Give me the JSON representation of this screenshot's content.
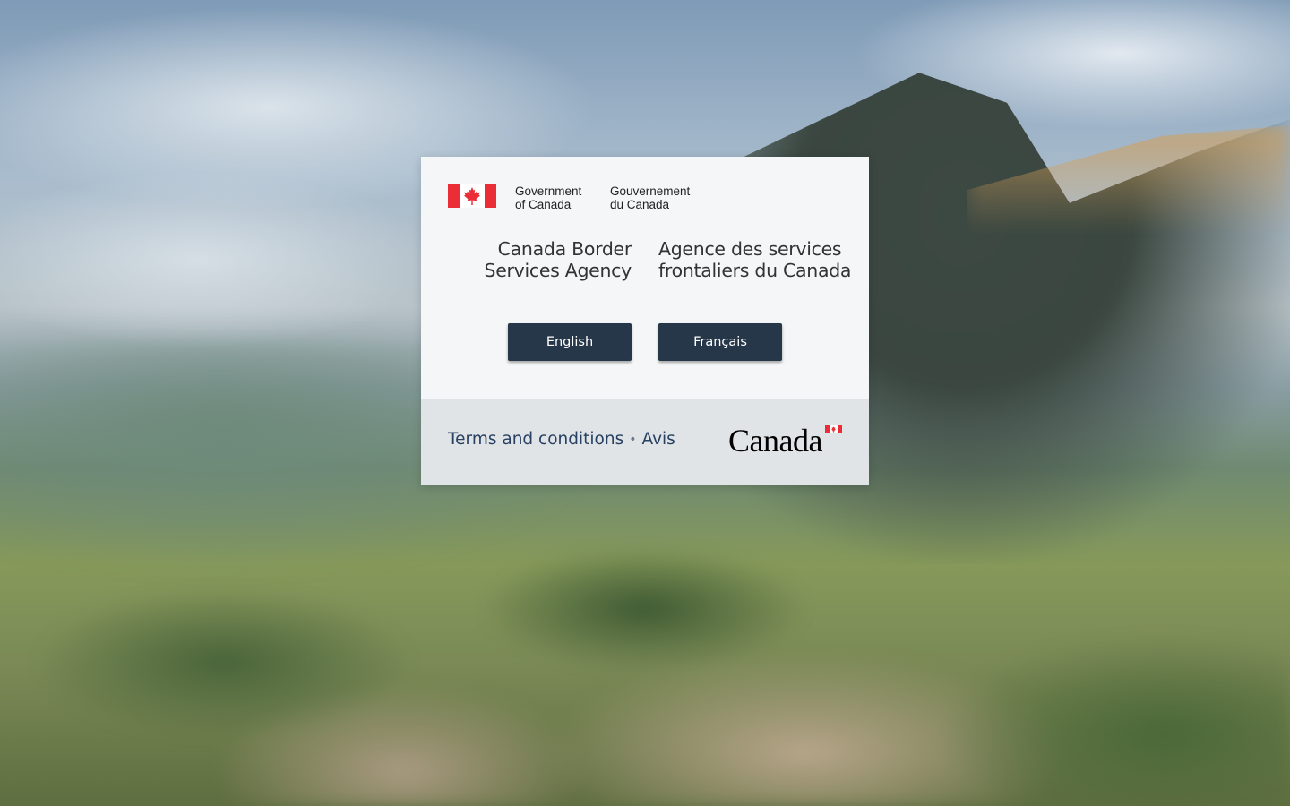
{
  "signature": {
    "en_line1": "Government",
    "en_line2": "of Canada",
    "fr_line1": "Gouvernement",
    "fr_line2": "du Canada",
    "flag_icon": "canada-flag-icon"
  },
  "agency": {
    "en": "Canada Border Services Agency",
    "fr": "Agence des services frontaliers du Canada"
  },
  "buttons": {
    "english": "English",
    "francais": "Français"
  },
  "footer": {
    "terms": "Terms and conditions",
    "separator": "•",
    "avis": "Avis",
    "wordmark": "Canada"
  },
  "colors": {
    "button_bg": "#26374a",
    "link": "#284162",
    "flag_red": "#eb2d37"
  }
}
